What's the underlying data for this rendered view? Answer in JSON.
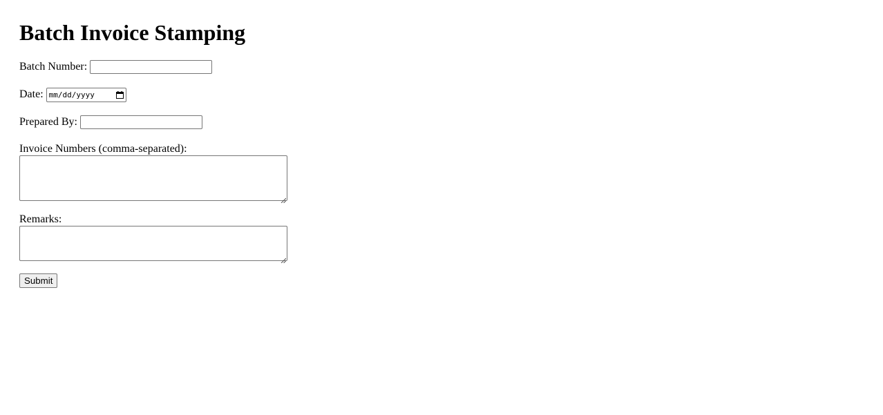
{
  "header": {
    "title": "Batch Invoice Stamping"
  },
  "form": {
    "batch_number": {
      "label": "Batch Number:",
      "value": ""
    },
    "date": {
      "label": "Date:",
      "placeholder": "mm/dd/yyyy",
      "icon": "calendar-icon"
    },
    "prepared_by": {
      "label": "Prepared By:",
      "value": ""
    },
    "invoice_numbers": {
      "label": "Invoice Numbers (comma-separated):",
      "value": ""
    },
    "remarks": {
      "label": "Remarks:",
      "value": ""
    },
    "submit_label": "Submit"
  },
  "colors": {
    "background": "#ffffff",
    "text": "#000000",
    "input_border": "#767676",
    "button_bg": "#efefef"
  }
}
